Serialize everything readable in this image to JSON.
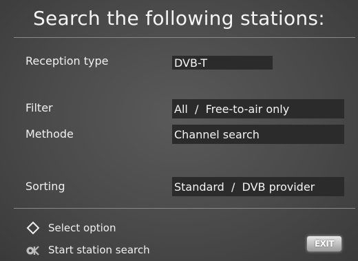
{
  "header": {
    "title": "Search the following stations:"
  },
  "settings": [
    {
      "label": "Reception type",
      "value": "DVB-T"
    },
    {
      "label": "Filter",
      "value": "All  /  Free-to-air only"
    },
    {
      "label": "Methode",
      "value": "Channel search"
    },
    {
      "label": "Sorting",
      "value": "Standard  /  DVB provider"
    }
  ],
  "footer": {
    "hints": [
      {
        "icon": "navigation-diamond-icon",
        "text": "Select option"
      },
      {
        "icon": "ok-button-icon",
        "text": "Start station search"
      }
    ],
    "exit_label": "EXIT"
  }
}
